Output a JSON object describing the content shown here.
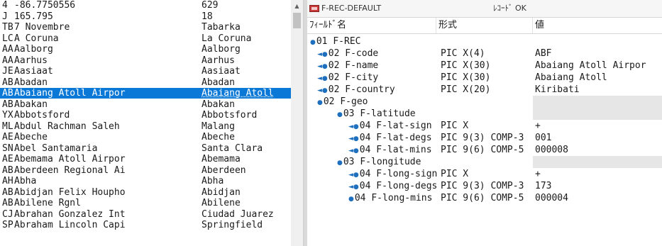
{
  "left_list": {
    "rows": [
      {
        "code": "4",
        "name": "-86.7750556",
        "city": "629"
      },
      {
        "code": "J",
        "name": "165.795",
        "city": "18"
      },
      {
        "code": "TBJ",
        "name": "7 Novembre",
        "city": "Tabarka"
      },
      {
        "code": "LCG",
        "name": "A Coruna",
        "city": "La Coruna"
      },
      {
        "code": "AAL",
        "name": "Aalborg",
        "city": "Aalborg"
      },
      {
        "code": "AAR",
        "name": "Aarhus",
        "city": "Aarhus"
      },
      {
        "code": "JEG",
        "name": "Aasiaat",
        "city": "Aasiaat"
      },
      {
        "code": "ABD",
        "name": "Abadan",
        "city": "Abadan"
      },
      {
        "code": "ABF",
        "name": "Abaiang Atoll Airpor",
        "city": "Abaiang Atoll",
        "selected": true
      },
      {
        "code": "ABA",
        "name": "Abakan",
        "city": "Abakan"
      },
      {
        "code": "YXX",
        "name": "Abbotsford",
        "city": "Abbotsford"
      },
      {
        "code": "MLG",
        "name": "Abdul Rachman Saleh",
        "city": "Malang"
      },
      {
        "code": "AEH",
        "name": "Abeche",
        "city": "Abeche"
      },
      {
        "code": "SNU",
        "name": "Abel Santamaria",
        "city": "Santa Clara"
      },
      {
        "code": "AEA",
        "name": "Abemama Atoll Airpor",
        "city": "Abemama"
      },
      {
        "code": "ABR",
        "name": "Aberdeen Regional Ai",
        "city": "Aberdeen"
      },
      {
        "code": "AHB",
        "name": "Abha",
        "city": "Abha"
      },
      {
        "code": "ABJ",
        "name": "Abidjan Felix Houpho",
        "city": "Abidjan"
      },
      {
        "code": "ABI",
        "name": "Abilene Rgnl",
        "city": "Abilene"
      },
      {
        "code": "CJS",
        "name": "Abrahan Gonzalez Int",
        "city": "Ciudad Juarez"
      },
      {
        "code": "SPI",
        "name": "Abraham Lincoln Capi",
        "city": "Springfield"
      }
    ]
  },
  "scrollbar": {
    "up_arrow": "▲"
  },
  "record": {
    "title": "F-REC-DEFAULT",
    "status": "ﾚｺｰﾄﾞ OK",
    "columns": {
      "name": "ﾌｨｰﾙﾄﾞ名",
      "format": "形式",
      "value": "値"
    },
    "rows": [
      {
        "name": "01 F-REC",
        "format": "",
        "value": "",
        "level": 0,
        "marker": "dot",
        "group": false
      },
      {
        "name": "02 F-code",
        "format": "PIC X(4)",
        "value": "ABF",
        "level": 1,
        "marker": "arrow",
        "group": false
      },
      {
        "name": "02 F-name",
        "format": "PIC X(30)",
        "value": "Abaiang Atoll Airpor",
        "level": 1,
        "marker": "arrow",
        "group": false
      },
      {
        "name": "02 F-city",
        "format": "PIC X(30)",
        "value": "Abaiang Atoll",
        "level": 1,
        "marker": "arrow",
        "group": false
      },
      {
        "name": "02 F-country",
        "format": "PIC X(20)",
        "value": "Kiribati",
        "level": 1,
        "marker": "arrow",
        "group": false
      },
      {
        "name": "02 F-geo",
        "format": "",
        "value": "",
        "level": 1,
        "marker": "dot",
        "group": true
      },
      {
        "name": "03 F-latitude",
        "format": "",
        "value": "",
        "level": 2,
        "marker": "dot",
        "group": true
      },
      {
        "name": "04 F-lat-sign",
        "format": "PIC X",
        "value": "+",
        "level": 3,
        "marker": "arrow",
        "group": false
      },
      {
        "name": "04 F-lat-degs",
        "format": "PIC 9(3) COMP-3",
        "value": "001",
        "level": 3,
        "marker": "arrow",
        "group": false
      },
      {
        "name": "04 F-lat-mins",
        "format": "PIC 9(6) COMP-5",
        "value": "000008",
        "level": 3,
        "marker": "arrow",
        "group": false
      },
      {
        "name": "03 F-longitude",
        "format": "",
        "value": "",
        "level": 2,
        "marker": "dot",
        "group": true
      },
      {
        "name": "04 F-long-sign",
        "format": "PIC X",
        "value": "+",
        "level": 3,
        "marker": "arrow",
        "group": false
      },
      {
        "name": "04 F-long-degs",
        "format": "PIC 9(3) COMP-3",
        "value": "173",
        "level": 3,
        "marker": "arrow",
        "group": false
      },
      {
        "name": "04 F-long-mins",
        "format": "PIC 9(6) COMP-5",
        "value": "000004",
        "level": 3,
        "marker": "dot",
        "group": false
      }
    ]
  }
}
